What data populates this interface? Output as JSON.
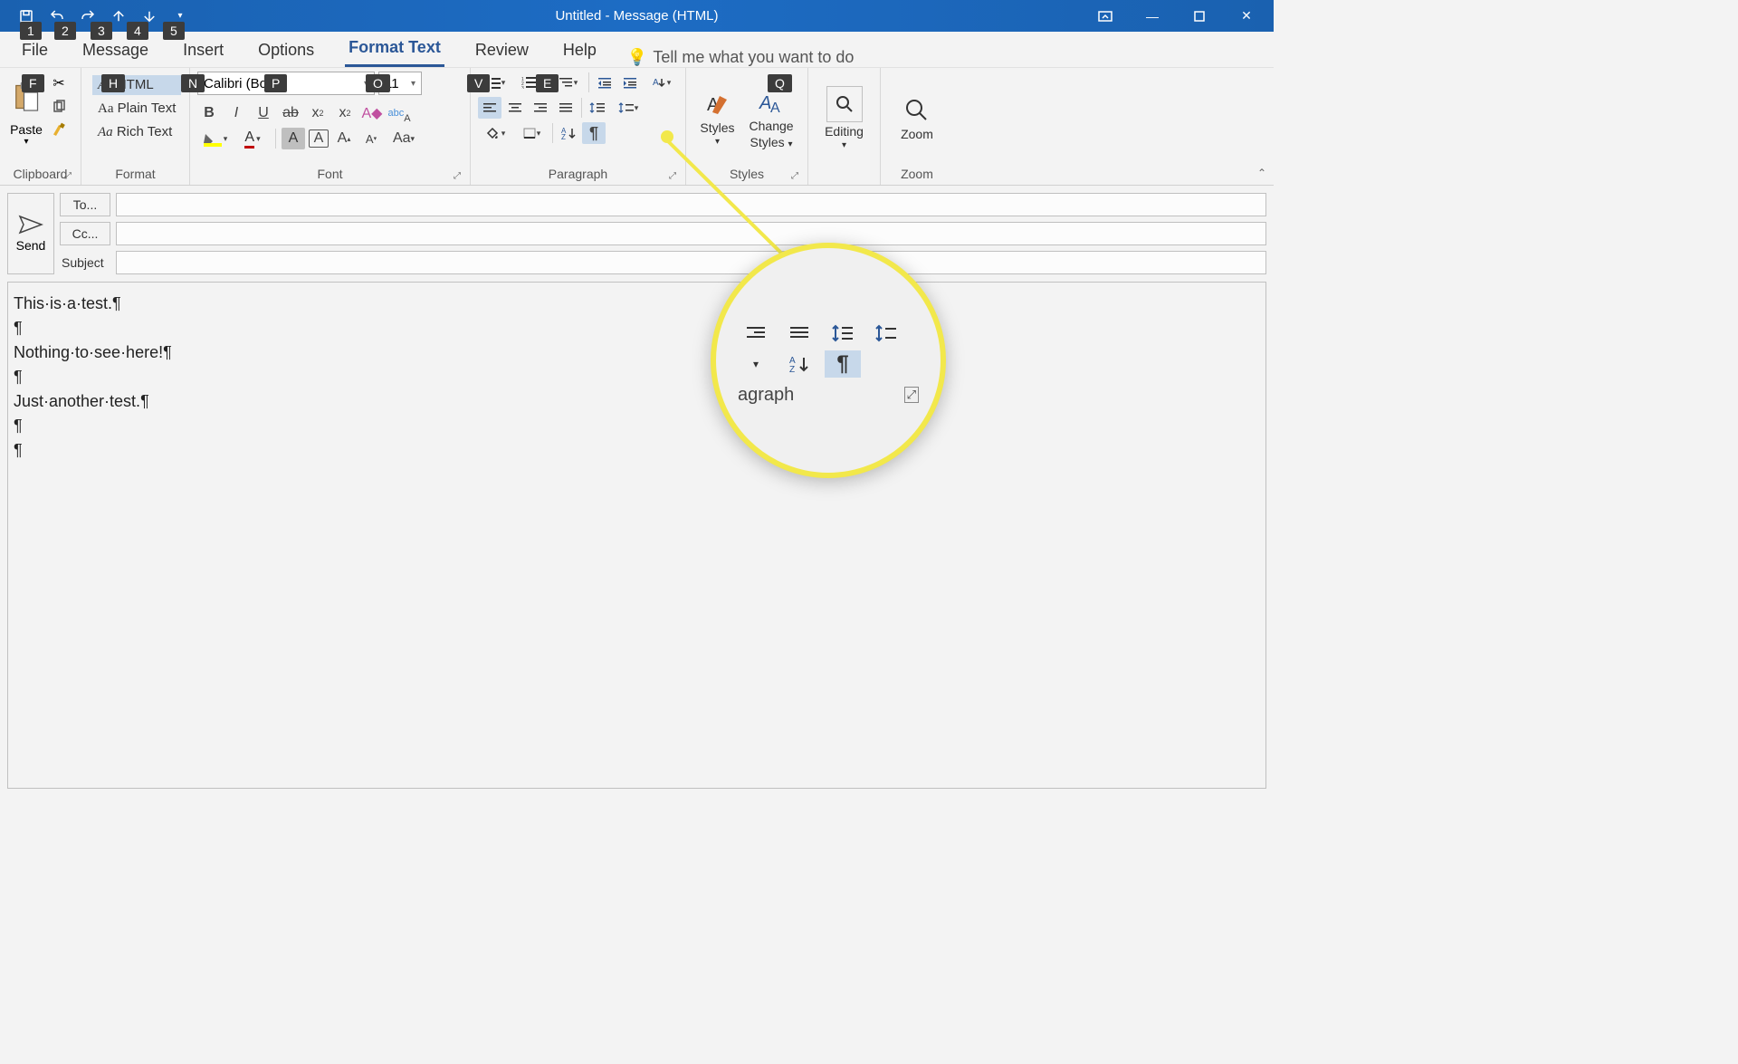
{
  "title": "Untitled  -  Message (HTML)",
  "qat": {
    "1": "save",
    "2": "undo",
    "3": "redo",
    "4": "prev",
    "5": "next"
  },
  "tabs": [
    "File",
    "Message",
    "Insert",
    "Options",
    "Format Text",
    "Review",
    "Help"
  ],
  "activeTab": "Format Text",
  "tellMe": "Tell me what you want to do",
  "groups": {
    "clipboard": {
      "label": "Clipboard",
      "paste": "Paste"
    },
    "format": {
      "label": "Format",
      "html": "HTML",
      "plain": "Plain Text",
      "rich": "Rich Text",
      "aa": "Aa"
    },
    "font": {
      "label": "Font",
      "name": "Calibri (Body)",
      "size": "11"
    },
    "paragraph": {
      "label": "Paragraph"
    },
    "styles": {
      "label": "Styles",
      "styles": "Styles",
      "change": "Change",
      "sublabel": "Styles"
    },
    "editing": {
      "label": "Editing"
    },
    "zoom": {
      "label": "Zoom"
    }
  },
  "keytips": {
    "1": "1",
    "2": "2",
    "3": "3",
    "4": "4",
    "5": "5",
    "F": "F",
    "H": "H",
    "N": "N",
    "P": "P",
    "O": "O",
    "V": "V",
    "E": "E",
    "Q": "Q"
  },
  "compose": {
    "send": "Send",
    "to": "To...",
    "cc": "Cc...",
    "subject": "Subject"
  },
  "body": {
    "l1": "This·is·a·test.¶",
    "l2": "¶",
    "l3": "Nothing·to·see·here!¶",
    "l4": "¶",
    "l5": "Just·another·test.¶",
    "l6": "¶",
    "l7": "¶"
  },
  "callout": {
    "label": "agraph"
  },
  "colors": {
    "accent": "#2b5797",
    "titlebar": "#1d6cc4",
    "highlight": "#f2e84b"
  }
}
